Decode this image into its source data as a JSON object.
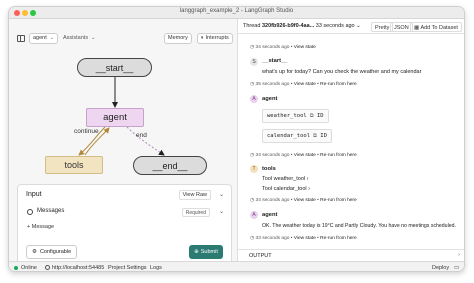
{
  "window": {
    "title": "langgraph_example_2 - LangGraph Studio"
  },
  "left_toolbar": {
    "graph_select": "agent",
    "assistants_label": "Assistants",
    "memory_button": "Memory",
    "interrupts_button": "Interrupts"
  },
  "graph": {
    "nodes": {
      "start": "__start__",
      "agent": "agent",
      "tools": "tools",
      "end": "__end__"
    },
    "edges": {
      "continue": "continue",
      "end": "end"
    }
  },
  "input_panel": {
    "title": "Input",
    "view_mode": "View Raw",
    "messages_label": "Messages",
    "required_label": "Required",
    "add_message": "+ Message",
    "configurable": "Configurable",
    "submit": "Submit"
  },
  "thread": {
    "label": "Thread",
    "id": "320fb926-b9f0-4aa...",
    "time": "33 seconds ago",
    "pretty": "Pretty",
    "json": "JSON",
    "add_to_dataset": "Add To Dataset"
  },
  "steps": [
    {
      "time": "34 seconds ago",
      "view": "View state",
      "rerun": ""
    },
    {
      "badge": "S",
      "label": "__start__",
      "text": "what's up for today? Can you check the weather and my calendar"
    },
    {
      "time": "35 seconds ago",
      "view": "View state",
      "rerun": "Re-run from here"
    },
    {
      "badge": "A",
      "label": "agent",
      "tools": [
        "weather_tool",
        "calendar_tool"
      ],
      "id_label": "ID"
    },
    {
      "time": "34 seconds ago",
      "view": "View state",
      "rerun": "Re-run from here"
    },
    {
      "badge": "T",
      "label": "tools",
      "lines": [
        "Tool  weather_tool",
        "Tool  calendar_tool"
      ]
    },
    {
      "time": "34 seconds ago",
      "view": "View state",
      "rerun": "Re-run from here"
    },
    {
      "badge": "A",
      "label": "agent",
      "text": "OK. The weather today is 19°C and Partly Cloudy. You have no meetings scheduled."
    },
    {
      "time": "33 seconds ago",
      "view": "View state",
      "rerun": "Re-run from here"
    }
  ],
  "output": {
    "label": "OUTPUT"
  },
  "statusbar": {
    "status": "Online",
    "url": "http://localhost:54485",
    "project_settings": "Project Settings",
    "logs": "Logs",
    "deploy": "Deploy"
  },
  "colors": {
    "agent_node": "#efd6f0",
    "tools_node": "#f2e3c1",
    "submit_button": "#2c7b73",
    "online_dot": "#1aa85c"
  }
}
